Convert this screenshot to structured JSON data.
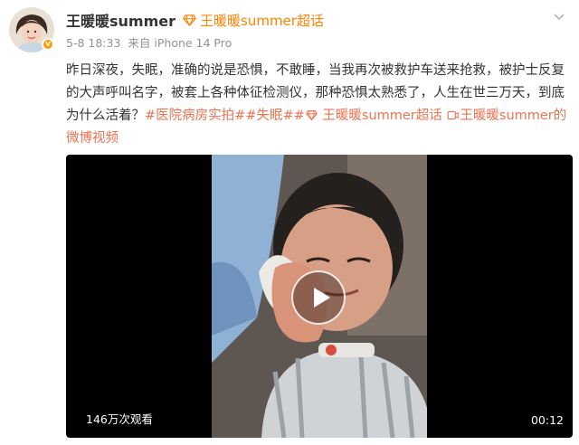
{
  "post": {
    "username": "王暖暖summer",
    "supertopic_label": "王暖暖summer超话",
    "timestamp": "5-8 18:33",
    "source": "来自 iPhone 14 Pro",
    "verified_badge": "v",
    "text": {
      "main": "昨日深夜，失眠，准确的说是恐惧，不敢睡，当我再次被救护车送来抢救，被护士反复的大声呼叫名字，被套上各种体征检测仪，那种恐惧太熟悉了，人生在世三万天，到底为什么活着？",
      "tag1": "#医院病房实拍#",
      "tag2": "#失眠#",
      "tag3": "王暖暖summer超话",
      "video_link": "王暖暖summer的微博视频"
    },
    "video": {
      "views": "146万次观看",
      "duration": "00:12"
    }
  },
  "icons": {
    "supertopic": "diamond-icon",
    "more": "chevron-down-icon",
    "video_link": "video-link-icon",
    "play": "play-icon"
  },
  "colors": {
    "accent": "#ff8200",
    "link": "#eb7350",
    "meta": "#939393",
    "text": "#333333"
  }
}
